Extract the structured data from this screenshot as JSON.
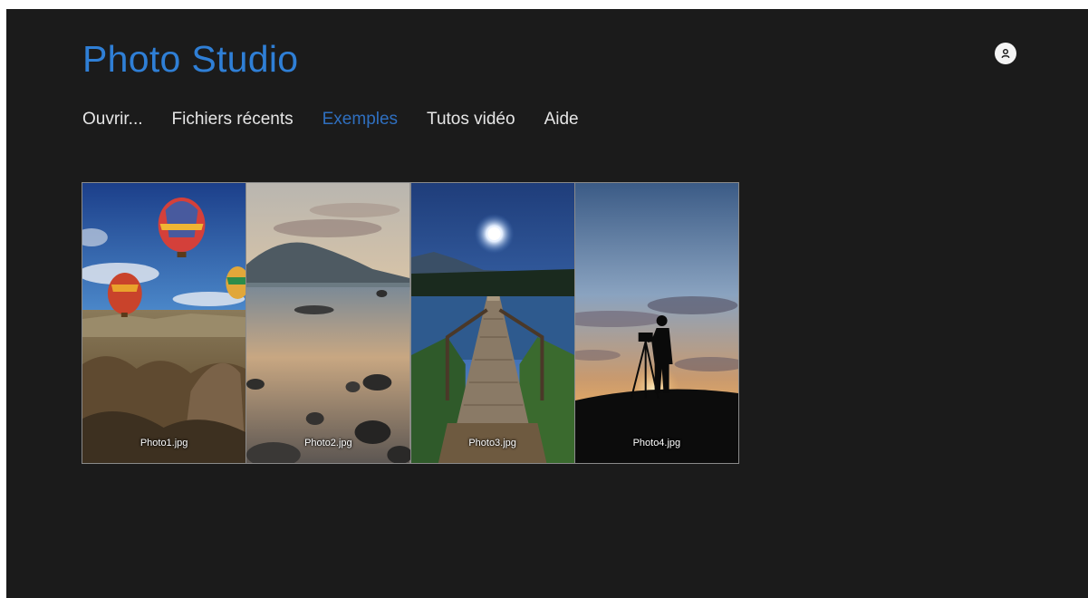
{
  "app": {
    "title": "Photo Studio",
    "accent_color": "#2f7fd6",
    "background_color": "#1b1b1b"
  },
  "header": {
    "account_icon": "user-icon"
  },
  "nav": {
    "items": [
      {
        "label": "Ouvrir...",
        "active": false
      },
      {
        "label": "Fichiers récents",
        "active": false
      },
      {
        "label": "Exemples",
        "active": true
      },
      {
        "label": "Tutos vidéo",
        "active": false
      },
      {
        "label": "Aide",
        "active": false
      }
    ]
  },
  "gallery": {
    "photos": [
      {
        "filename": "Photo1.jpg",
        "subject": "hot-air-balloons-over-canyon"
      },
      {
        "filename": "Photo2.jpg",
        "subject": "mountain-lake-with-rocks"
      },
      {
        "filename": "Photo3.jpg",
        "subject": "wooden-pier-at-night"
      },
      {
        "filename": "Photo4.jpg",
        "subject": "photographer-silhouette-sunset"
      }
    ]
  }
}
